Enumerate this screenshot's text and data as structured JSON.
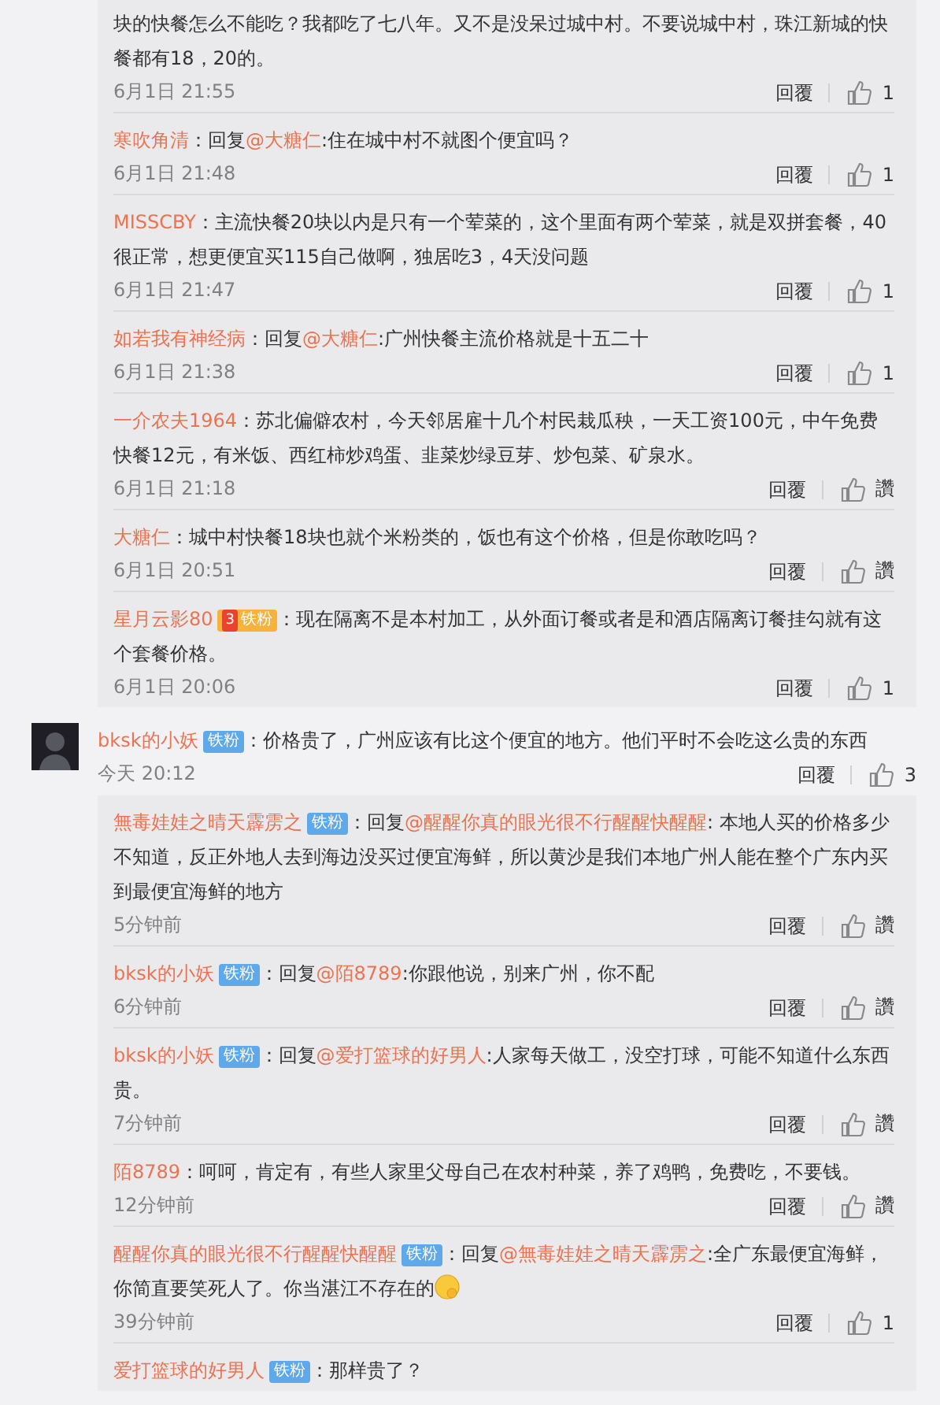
{
  "upper_replies": [
    {
      "text": "块的快餐怎么不能吃？我都吃了七八年。又不是没呆过城中村。不要说城中村，珠江新城的快餐都有18，20的。",
      "time": "6月1日 21:55",
      "reply": "回覆",
      "likes": "1"
    },
    {
      "author": "寒吹角清",
      "colon": "：",
      "reply_prefix": "回复",
      "mention": "@大糖仁",
      "text": ":住在城中村不就图个便宜吗？",
      "time": "6月1日 21:48",
      "reply": "回覆",
      "likes": "1"
    },
    {
      "author": "MISSCBY",
      "colon": "：",
      "text": "主流快餐20块以内是只有一个荤菜的，这个里面有两个荤菜，就是双拼套餐，40很正常，想更便宜买115自己做啊，独居吃3，4天没问题",
      "time": "6月1日 21:47",
      "reply": "回覆",
      "likes": "1"
    },
    {
      "author": "如若我有神经病",
      "colon": "：",
      "reply_prefix": "回复",
      "mention": "@大糖仁",
      "text": ":广州快餐主流价格就是十五二十",
      "time": "6月1日 21:38",
      "reply": "回覆",
      "likes": "1"
    },
    {
      "author": "一介农夫1964",
      "colon": "：",
      "text": "苏北偏僻农村，今天邻居雇十几个村民栽瓜秧，一天工资100元，中午免费快餐12元，有米饭、西红柿炒鸡蛋、韭菜炒绿豆芽、炒包菜、矿泉水。",
      "time": "6月1日 21:18",
      "reply": "回覆",
      "likes": "讚"
    },
    {
      "author": "大糖仁",
      "colon": "：",
      "text": "城中村快餐18块也就个米粉类的，饭也有这个价格，但是你敢吃吗？",
      "time": "6月1日 20:51",
      "reply": "回覆",
      "likes": "讚"
    },
    {
      "author": "星月云影80",
      "badge": {
        "kind": "gold",
        "level": "3",
        "label": "铁粉"
      },
      "colon": "：",
      "text": "现在隔离不是本村加工，从外面订餐或者是和酒店隔离订餐挂勾就有这个套餐价格。",
      "time": "6月1日 20:06",
      "reply": "回覆",
      "likes": "1"
    }
  ],
  "comment": {
    "author": "bksk的小妖",
    "badge": {
      "kind": "blue",
      "label": "铁粉"
    },
    "colon": "：",
    "text": "价格贵了，广州应该有比这个便宜的地方。他们平时不会吃这么贵的东西",
    "time": "今天 20:12",
    "reply": "回覆",
    "likes": "3",
    "replies": [
      {
        "author": "無毒娃娃之晴天霹雳之",
        "badge": {
          "kind": "blue",
          "label": "铁粉"
        },
        "colon": "：",
        "reply_prefix": "回复",
        "mention": "@醒醒你真的眼光很不行醒醒快醒醒",
        "text": ": 本地人买的价格多少不知道，反正外地人去到海边没买过便宜海鲜，所以黄沙是我们本地广州人能在整个广东内买到最便宜海鲜的地方",
        "time": "5分钟前",
        "reply": "回覆",
        "likes": "讚"
      },
      {
        "author": "bksk的小妖",
        "badge": {
          "kind": "blue",
          "label": "铁粉"
        },
        "colon": "：",
        "reply_prefix": "回复",
        "mention": "@陌8789",
        "text": ":你跟他说，别来广州，你不配",
        "time": "6分钟前",
        "reply": "回覆",
        "likes": "讚"
      },
      {
        "author": "bksk的小妖",
        "badge": {
          "kind": "blue",
          "label": "铁粉"
        },
        "colon": "：",
        "reply_prefix": "回复",
        "mention": "@爱打篮球的好男人",
        "text": ":人家每天做工，没空打球，可能不知道什么东西贵。",
        "time": "7分钟前",
        "reply": "回覆",
        "likes": "讚"
      },
      {
        "author": "陌8789",
        "colon": "：",
        "text": "呵呵，肯定有，有些人家里父母自己在农村种菜，养了鸡鸭，免费吃，不要钱。",
        "time": "12分钟前",
        "reply": "回覆",
        "likes": "讚"
      },
      {
        "author": "醒醒你真的眼光很不行醒醒快醒醒",
        "badge": {
          "kind": "blue",
          "label": "铁粉"
        },
        "colon": "：",
        "reply_prefix": "回复",
        "mention": "@無毒娃娃之晴天霹雳之",
        "text": ":全广东最便宜海鲜，你简直要笑死人了。你当湛江不存在的",
        "emoji": true,
        "time": "39分钟前",
        "reply": "回覆",
        "likes": "1"
      },
      {
        "author": "爱打篮球的好男人",
        "badge": {
          "kind": "blue",
          "label": "铁粉"
        },
        "colon": "：",
        "text": "那样贵了？"
      }
    ]
  }
}
